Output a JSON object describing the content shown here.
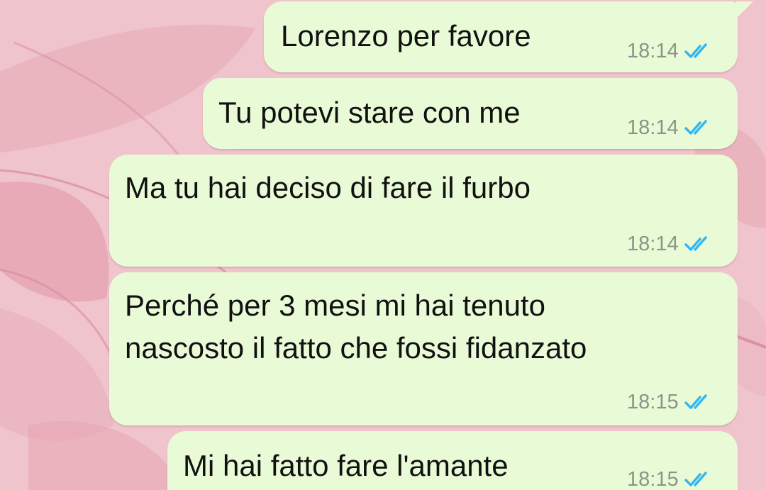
{
  "chat": {
    "messages": [
      {
        "lines": [
          "Lorenzo per favore"
        ],
        "time": "18:14",
        "status": "read",
        "status_icon": "double-check-icon"
      },
      {
        "lines": [
          "Tu potevi stare con me"
        ],
        "time": "18:14",
        "status": "read",
        "status_icon": "double-check-icon"
      },
      {
        "lines": [
          "Ma tu hai deciso di fare il furbo"
        ],
        "time": "18:14",
        "status": "read",
        "status_icon": "double-check-icon"
      },
      {
        "lines": [
          "Perché per 3 mesi mi hai tenuto",
          "nascosto il fatto che fossi fidanzato"
        ],
        "time": "18:15",
        "status": "read",
        "status_icon": "double-check-icon"
      },
      {
        "lines": [
          "Mi hai fatto fare l'amante"
        ],
        "time": "18:15",
        "status": "read",
        "status_icon": "double-check-icon"
      }
    ]
  },
  "colors": {
    "wallpaper": "#efc4cc",
    "outgoing_bubble": "#e9fbd6",
    "message_text": "#111111",
    "timestamp": "#8a9488",
    "read_ticks": "#34b7f1"
  }
}
